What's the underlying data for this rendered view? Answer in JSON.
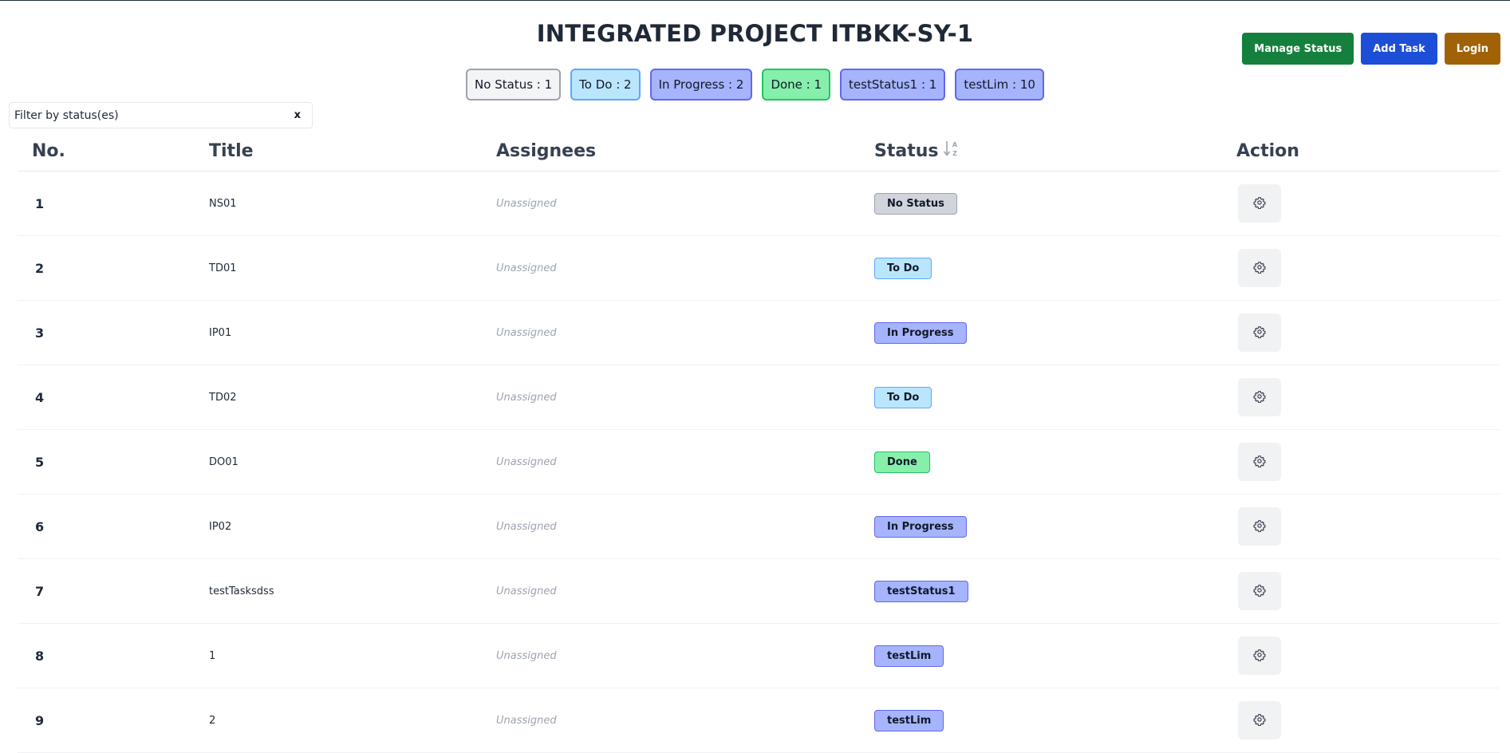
{
  "header": {
    "title": "INTEGRATED PROJECT ITBKK-SY-1"
  },
  "actions": [
    {
      "label": "Manage Status",
      "color": "#15803d"
    },
    {
      "label": "Add Task",
      "color": "#1d4ed8"
    },
    {
      "label": "Login",
      "color": "#a16207"
    }
  ],
  "summary": [
    {
      "label": "No Status : 1",
      "bg": "#f3f4f6",
      "border": "#9ca3af"
    },
    {
      "label": "To Do : 2",
      "bg": "#bae6fd",
      "border": "#60a5fa"
    },
    {
      "label": "In Progress : 2",
      "bg": "#a5b4fc",
      "border": "#6366f1"
    },
    {
      "label": "Done : 1",
      "bg": "#86efac",
      "border": "#22c55e"
    },
    {
      "label": "testStatus1 : 1",
      "bg": "#a5b4fc",
      "border": "#6366f1"
    },
    {
      "label": "testLim : 10",
      "bg": "#a5b4fc",
      "border": "#6366f1"
    }
  ],
  "filter": {
    "placeholder": "Filter by status(es)",
    "clear": "x"
  },
  "table": {
    "columns": [
      "No.",
      "Title",
      "Assignees",
      "Status",
      "Action"
    ],
    "sort_icon": "sort-alpha-down-icon",
    "rows": [
      {
        "no": "1",
        "title": "NS01",
        "assignees": "Unassigned",
        "status": "No Status",
        "bg": "#d1d5db",
        "border": "#9ca3af"
      },
      {
        "no": "2",
        "title": "TD01",
        "assignees": "Unassigned",
        "status": "To Do",
        "bg": "#bae6fd",
        "border": "#60a5fa"
      },
      {
        "no": "3",
        "title": "IP01",
        "assignees": "Unassigned",
        "status": "In Progress",
        "bg": "#a5b4fc",
        "border": "#6366f1"
      },
      {
        "no": "4",
        "title": "TD02",
        "assignees": "Unassigned",
        "status": "To Do",
        "bg": "#bae6fd",
        "border": "#60a5fa"
      },
      {
        "no": "5",
        "title": "DO01",
        "assignees": "Unassigned",
        "status": "Done",
        "bg": "#86efac",
        "border": "#22c55e"
      },
      {
        "no": "6",
        "title": "IP02",
        "assignees": "Unassigned",
        "status": "In Progress",
        "bg": "#a5b4fc",
        "border": "#6366f1"
      },
      {
        "no": "7",
        "title": "testTasksdss",
        "assignees": "Unassigned",
        "status": "testStatus1",
        "bg": "#a5b4fc",
        "border": "#6366f1"
      },
      {
        "no": "8",
        "title": "1",
        "assignees": "Unassigned",
        "status": "testLim",
        "bg": "#a5b4fc",
        "border": "#6366f1"
      },
      {
        "no": "9",
        "title": "2",
        "assignees": "Unassigned",
        "status": "testLim",
        "bg": "#a5b4fc",
        "border": "#6366f1"
      }
    ]
  }
}
